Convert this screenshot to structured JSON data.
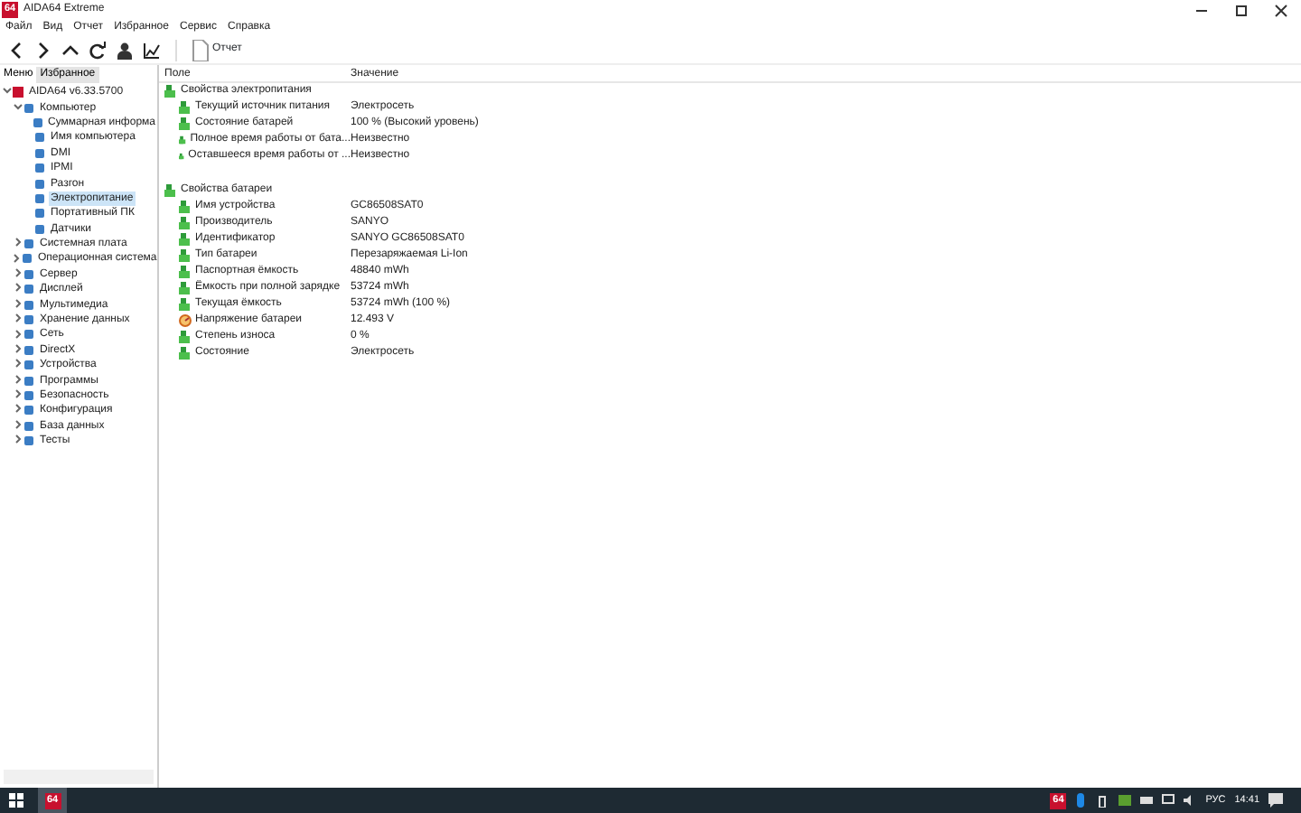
{
  "window": {
    "title": "AIDA64 Extreme",
    "logo": "64"
  },
  "menu": [
    "Файл",
    "Вид",
    "Отчет",
    "Избранное",
    "Сервис",
    "Справка"
  ],
  "toolbar": {
    "report_button": "Отчет"
  },
  "sidebar": {
    "tabs": [
      {
        "label": "Меню",
        "selected": false
      },
      {
        "label": "Избранное",
        "selected": true
      }
    ],
    "tree": [
      {
        "label": "AIDA64 v6.33.5700",
        "expanded": true,
        "selected": false,
        "children": [
          {
            "label": "Компьютер",
            "expanded": true,
            "selected": false,
            "children": [
              {
                "label": "Суммарная информа",
                "selected": false
              },
              {
                "label": "Имя компьютера",
                "selected": false
              },
              {
                "label": "DMI",
                "selected": false
              },
              {
                "label": "IPMI",
                "selected": false
              },
              {
                "label": "Разгон",
                "selected": false
              },
              {
                "label": "Электропитание",
                "selected": true
              },
              {
                "label": "Портативный ПК",
                "selected": false
              },
              {
                "label": "Датчики",
                "selected": false
              }
            ]
          },
          {
            "label": "Системная плата",
            "expanded": false,
            "selected": false
          },
          {
            "label": "Операционная система",
            "expanded": false,
            "selected": false
          },
          {
            "label": "Сервер",
            "expanded": false,
            "selected": false
          },
          {
            "label": "Дисплей",
            "expanded": false,
            "selected": false
          },
          {
            "label": "Мультимедиа",
            "expanded": false,
            "selected": false
          },
          {
            "label": "Хранение данных",
            "expanded": false,
            "selected": false
          },
          {
            "label": "Сеть",
            "expanded": false,
            "selected": false
          },
          {
            "label": "DirectX",
            "expanded": false,
            "selected": false
          },
          {
            "label": "Устройства",
            "expanded": false,
            "selected": false
          },
          {
            "label": "Программы",
            "expanded": false,
            "selected": false
          },
          {
            "label": "Безопасность",
            "expanded": false,
            "selected": false
          },
          {
            "label": "Конфигурация",
            "expanded": false,
            "selected": false
          },
          {
            "label": "База данных",
            "expanded": false,
            "selected": false
          },
          {
            "label": "Тесты",
            "expanded": false,
            "selected": false
          }
        ]
      }
    ]
  },
  "table": {
    "columns": [
      "Поле",
      "Значение"
    ],
    "groups": [
      {
        "title": "Свойства электропитания",
        "rows": [
          {
            "kind": "battery",
            "field": "Текущий источник питания",
            "value": "Электросеть"
          },
          {
            "kind": "battery",
            "field": "Состояние батарей",
            "value": "100 % (Высокий уровень)"
          },
          {
            "kind": "battery",
            "field": "Полное время работы от бата...",
            "value": "Неизвестно"
          },
          {
            "kind": "battery",
            "field": "Оставшееся время работы от ...",
            "value": "Неизвестно"
          }
        ]
      },
      {
        "title": "Свойства батареи",
        "rows": [
          {
            "kind": "battery",
            "field": "Имя устройства",
            "value": "GC86508SAT0"
          },
          {
            "kind": "battery",
            "field": "Производитель",
            "value": "SANYO"
          },
          {
            "kind": "battery",
            "field": "Идентификатор",
            "value": "SANYO GC86508SAT0"
          },
          {
            "kind": "battery",
            "field": "Тип батареи",
            "value": "Перезаряжаемая Li-Ion"
          },
          {
            "kind": "battery",
            "field": "Паспортная ёмкость",
            "value": "48840 mWh"
          },
          {
            "kind": "battery",
            "field": "Ёмкость при полной зарядке",
            "value": "53724 mWh"
          },
          {
            "kind": "battery",
            "field": "Текущая ёмкость",
            "value": "53724 mWh  (100 %)"
          },
          {
            "kind": "gauge",
            "field": "Напряжение батареи",
            "value": "12.493 V"
          },
          {
            "kind": "battery",
            "field": "Степень износа",
            "value": "0 %"
          },
          {
            "kind": "battery",
            "field": "Состояние",
            "value": "Электросеть"
          }
        ]
      }
    ]
  },
  "taskbar": {
    "tray_app": "64",
    "language": "РУС",
    "time": "14:41",
    "app": "64"
  }
}
